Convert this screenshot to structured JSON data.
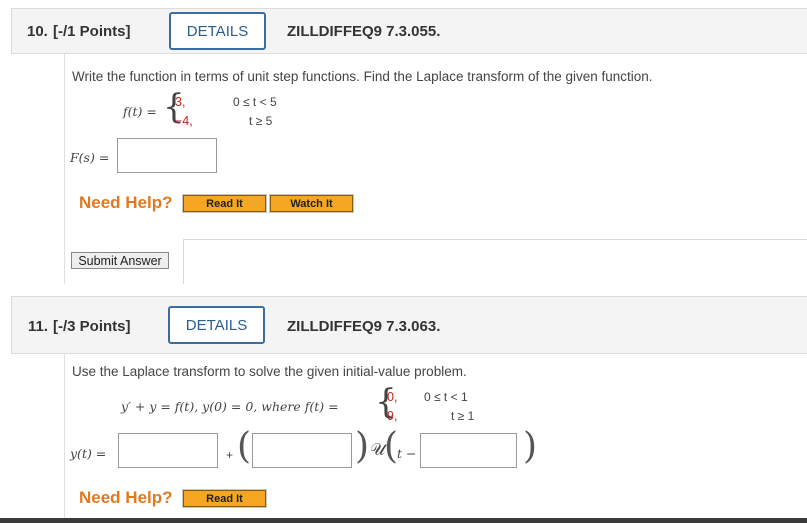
{
  "q10": {
    "number": "10.",
    "points": "[-/1 Points]",
    "details_label": "DETAILS",
    "reference": "ZILLDIFFEQ9 7.3.055.",
    "prompt": "Write the function in terms of unit step functions. Find the Laplace transform of the given function.",
    "f_label": "f(t) =",
    "case1_value": "3,",
    "case1_cond": "0 ≤ t < 5",
    "case2_value": "−4,",
    "case2_cond": "t ≥ 5",
    "answer_label": "F(s) =",
    "answer_value": "",
    "need_help": "Need Help?",
    "read_it": "Read It",
    "watch_it": "Watch It",
    "submit": "Submit Answer"
  },
  "q11": {
    "number": "11.",
    "points": "[-/3 Points]",
    "details_label": "DETAILS",
    "reference": "ZILLDIFFEQ9 7.3.063.",
    "prompt": "Use the Laplace transform to solve the given initial-value problem.",
    "equation": "y′ + y = f(t),   y(0) = 0, where f(t) =",
    "case1_value": "0,",
    "case1_cond": "0 ≤ t < 1",
    "case2_value": "9,",
    "case2_cond": "t ≥ 1",
    "answer_label": "y(t) =",
    "plus": "+",
    "step_symbol": "𝒰",
    "t_minus": "t −",
    "answer1": "",
    "answer2": "",
    "answer3": "",
    "need_help": "Need Help?",
    "read_it": "Read It"
  }
}
